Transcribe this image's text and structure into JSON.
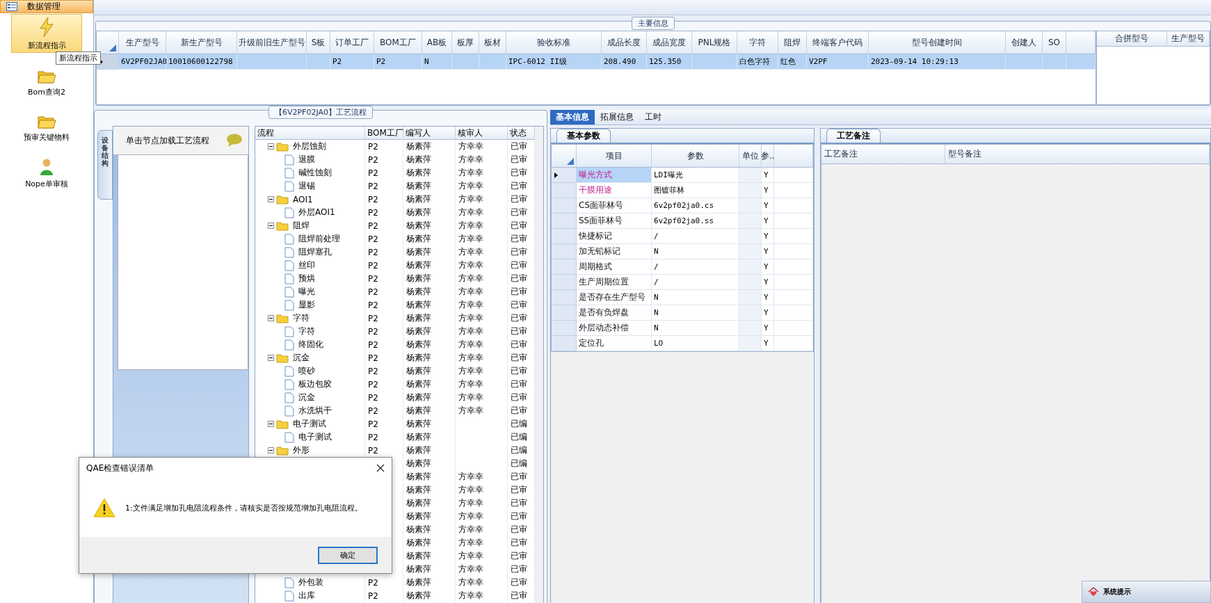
{
  "sidebar": {
    "header": "数据管理",
    "items": [
      {
        "label": "新流程指示",
        "kind": "bolt",
        "selected": true
      },
      {
        "label": "Bom查询2",
        "kind": "folder",
        "selected": false
      },
      {
        "label": "预审关键物料",
        "kind": "folder",
        "selected": false
      },
      {
        "label": "Nope单审核",
        "kind": "person",
        "selected": false
      }
    ]
  },
  "tooltip": "新流程指示",
  "main_info": {
    "title": "主要信息",
    "columns": [
      "生产型号",
      "新生产型号",
      "升级前旧生产型号",
      "S板",
      "订单工厂",
      "BOM工厂",
      "AB板",
      "板厚",
      "板材",
      "验收标准",
      "成品长度",
      "成品宽度",
      "PNL规格",
      "字符",
      "阻焊",
      "终端客户代码",
      "型号创建时间",
      "创建人",
      "SO"
    ],
    "rows": [
      {
        "selected": true,
        "cells": [
          "6V2PF02JA0",
          "10010600122798",
          "",
          "",
          "P2",
          "P2",
          "N",
          "",
          "",
          "IPC-6012 II级",
          "208.490",
          "125.350",
          "",
          "白色字符",
          "红色",
          "V2PF",
          "2023-09-14 10:29:13",
          "",
          ""
        ]
      }
    ],
    "side_columns": [
      "合拼型号",
      "生产型号"
    ]
  },
  "process": {
    "title": "【6V2PF02JA0】工艺流程",
    "side_tab": "设备结构",
    "hint": "单击节点加载工艺流程",
    "columns": [
      "流程",
      "BOM工厂",
      "编写人",
      "核审人",
      "状态"
    ],
    "tree": [
      {
        "name": "外层蚀刻",
        "bom": "P2",
        "writer": "杨素萍",
        "reviewer": "方幸幸",
        "status": "已审",
        "expanded": true,
        "children": [
          {
            "name": "退膜",
            "bom": "P2",
            "writer": "杨素萍",
            "reviewer": "方幸幸",
            "status": "已审"
          },
          {
            "name": "碱性蚀刻",
            "bom": "P2",
            "writer": "杨素萍",
            "reviewer": "方幸幸",
            "status": "已审"
          },
          {
            "name": "退锡",
            "bom": "P2",
            "writer": "杨素萍",
            "reviewer": "方幸幸",
            "status": "已审"
          }
        ]
      },
      {
        "name": "AOI1",
        "bom": "P2",
        "writer": "杨素萍",
        "reviewer": "方幸幸",
        "status": "已审",
        "expanded": true,
        "children": [
          {
            "name": "外层AOI1",
            "bom": "P2",
            "writer": "杨素萍",
            "reviewer": "方幸幸",
            "status": "已审"
          }
        ]
      },
      {
        "name": "阻焊",
        "bom": "P2",
        "writer": "杨素萍",
        "reviewer": "方幸幸",
        "status": "已审",
        "expanded": true,
        "children": [
          {
            "name": "阻焊前处理",
            "bom": "P2",
            "writer": "杨素萍",
            "reviewer": "方幸幸",
            "status": "已审"
          },
          {
            "name": "阻焊塞孔",
            "bom": "P2",
            "writer": "杨素萍",
            "reviewer": "方幸幸",
            "status": "已审"
          },
          {
            "name": "丝印",
            "bom": "P2",
            "writer": "杨素萍",
            "reviewer": "方幸幸",
            "status": "已审"
          },
          {
            "name": "预烘",
            "bom": "P2",
            "writer": "杨素萍",
            "reviewer": "方幸幸",
            "status": "已审"
          },
          {
            "name": "曝光",
            "bom": "P2",
            "writer": "杨素萍",
            "reviewer": "方幸幸",
            "status": "已审"
          },
          {
            "name": "显影",
            "bom": "P2",
            "writer": "杨素萍",
            "reviewer": "方幸幸",
            "status": "已审"
          }
        ]
      },
      {
        "name": "字符",
        "bom": "P2",
        "writer": "杨素萍",
        "reviewer": "方幸幸",
        "status": "已审",
        "expanded": true,
        "children": [
          {
            "name": "字符",
            "bom": "P2",
            "writer": "杨素萍",
            "reviewer": "方幸幸",
            "status": "已审"
          },
          {
            "name": "终固化",
            "bom": "P2",
            "writer": "杨素萍",
            "reviewer": "方幸幸",
            "status": "已审"
          }
        ]
      },
      {
        "name": "沉金",
        "bom": "P2",
        "writer": "杨素萍",
        "reviewer": "方幸幸",
        "status": "已审",
        "expanded": true,
        "children": [
          {
            "name": "喷砂",
            "bom": "P2",
            "writer": "杨素萍",
            "reviewer": "方幸幸",
            "status": "已审"
          },
          {
            "name": "板边包胶",
            "bom": "P2",
            "writer": "杨素萍",
            "reviewer": "方幸幸",
            "status": "已审"
          },
          {
            "name": "沉金",
            "bom": "P2",
            "writer": "杨素萍",
            "reviewer": "方幸幸",
            "status": "已审"
          },
          {
            "name": "水洗烘干",
            "bom": "P2",
            "writer": "杨素萍",
            "reviewer": "方幸幸",
            "status": "已审"
          }
        ]
      },
      {
        "name": "电子测试",
        "bom": "P2",
        "writer": "杨素萍",
        "status": "已编",
        "expanded": true,
        "children": [
          {
            "name": "电子测试",
            "bom": "P2",
            "writer": "杨素萍",
            "status": "已编"
          }
        ]
      },
      {
        "name": "外形",
        "bom": "P2",
        "writer": "杨素萍",
        "status": "已编",
        "expanded": true,
        "children": [
          {
            "writer": "杨素萍",
            "status": "已编"
          },
          {
            "writer": "杨素萍",
            "reviewer": "方幸幸",
            "status": "已审"
          },
          {
            "writer": "杨素萍",
            "reviewer": "方幸幸",
            "status": "已审"
          },
          {
            "writer": "杨素萍",
            "reviewer": "方幸幸",
            "status": "已审"
          },
          {
            "writer": "杨素萍",
            "reviewer": "方幸幸",
            "status": "已审"
          },
          {
            "writer": "杨素萍",
            "reviewer": "方幸幸",
            "status": "已审"
          },
          {
            "writer": "杨素萍",
            "reviewer": "方幸幸",
            "status": "已审"
          },
          {
            "writer": "杨素萍",
            "reviewer": "方幸幸",
            "status": "已审"
          },
          {
            "writer": "杨素萍",
            "reviewer": "方幸幸",
            "status": "已审"
          },
          {
            "name": "外包装",
            "bom": "P2",
            "writer": "杨素萍",
            "reviewer": "方幸幸",
            "status": "已审"
          },
          {
            "name": "出库",
            "bom": "P2",
            "writer": "杨素萍",
            "reviewer": "方幸幸",
            "status": "已审"
          }
        ]
      }
    ]
  },
  "detail": {
    "tabs": [
      {
        "label": "基本信息",
        "selected": true
      },
      {
        "label": "拓展信息",
        "selected": false
      },
      {
        "label": "工时",
        "selected": false
      }
    ],
    "params": {
      "tab": "基本参数",
      "columns": [
        "项目",
        "参数",
        "单位",
        "参.."
      ],
      "rows": [
        {
          "item": "曝光方式",
          "value": "LDI曝光",
          "flag": "Y",
          "kind": "key",
          "selected": true
        },
        {
          "item": "干膜用途",
          "value": "图镀菲林",
          "flag": "Y",
          "kind": "key",
          "selected": false
        },
        {
          "item": "CS面菲林号",
          "value": "6v2pf02ja0.cs",
          "flag": "Y",
          "kind": "plain",
          "selected": false
        },
        {
          "item": "SS面菲林号",
          "value": "6v2pf02ja0.ss",
          "flag": "Y",
          "kind": "plain",
          "selected": false
        },
        {
          "item": "快捷标记",
          "value": "/",
          "flag": "Y",
          "kind": "plain",
          "selected": false
        },
        {
          "item": "加无铅标记",
          "value": "N",
          "flag": "Y",
          "kind": "plain",
          "selected": false
        },
        {
          "item": "周期格式",
          "value": "/",
          "flag": "Y",
          "kind": "plain",
          "selected": false
        },
        {
          "item": "生产周期位置",
          "value": "/",
          "flag": "Y",
          "kind": "plain",
          "selected": false
        },
        {
          "item": "是否存在生产型号",
          "value": "N",
          "flag": "Y",
          "kind": "plain",
          "selected": false
        },
        {
          "item": "是否有负焊盘",
          "value": "N",
          "flag": "Y",
          "kind": "plain",
          "selected": false
        },
        {
          "item": "外层动态补偿",
          "value": "N",
          "flag": "Y",
          "kind": "plain",
          "selected": false
        },
        {
          "item": "定位孔",
          "value": "LO",
          "flag": "Y",
          "kind": "plain",
          "selected": false
        }
      ]
    },
    "notes": {
      "tab": "工艺备注",
      "columns": [
        "工艺备注",
        "型号备注"
      ]
    }
  },
  "dialog": {
    "title": "QAE检查错误清单",
    "message": "1:文件满足增加孔电阻流程条件，请核实是否按规范增加孔电阻流程。",
    "button": "确定"
  },
  "system_popup": {
    "title": "系统提示"
  }
}
